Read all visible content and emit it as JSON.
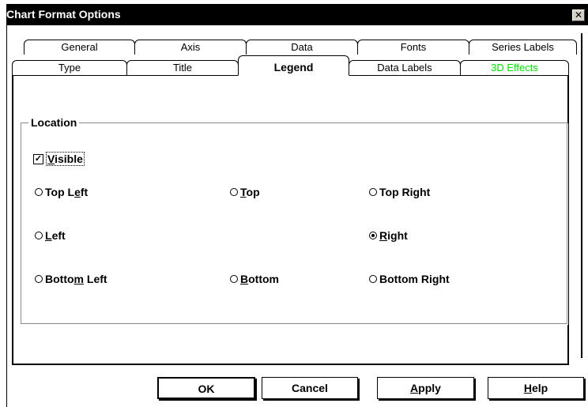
{
  "window": {
    "title": "Chart Format Options",
    "close_symbol": "✕"
  },
  "tabs_back": [
    {
      "label": "General"
    },
    {
      "label": "Axis"
    },
    {
      "label": "Data"
    },
    {
      "label": "Fonts"
    },
    {
      "label": "Series Labels"
    }
  ],
  "tabs_front": [
    {
      "label": "Type"
    },
    {
      "label": "Title"
    },
    {
      "label": "Legend",
      "active": true
    },
    {
      "label": "Data Labels"
    },
    {
      "label": "3D Effects",
      "color": "#00e000"
    }
  ],
  "location": {
    "group_label": "Location",
    "visible": {
      "label_pre": "",
      "mnemonic": "V",
      "label_post": "isible",
      "checked": true,
      "check_symbol": "✓"
    },
    "options": {
      "top_left": {
        "pre": "Top L",
        "mn": "e",
        "post": "ft",
        "selected": false
      },
      "top": {
        "pre": "",
        "mn": "T",
        "post": "op",
        "selected": false
      },
      "top_right": {
        "pre": "Top Ri",
        "mn": "g",
        "post": "ht",
        "selected": false
      },
      "left": {
        "pre": "",
        "mn": "L",
        "post": "eft",
        "selected": false
      },
      "right": {
        "pre": "",
        "mn": "R",
        "post": "ight",
        "selected": true
      },
      "bottom_left": {
        "pre": "Botto",
        "mn": "m",
        "post": " Left",
        "selected": false
      },
      "bottom": {
        "pre": "",
        "mn": "B",
        "post": "ottom",
        "selected": false
      },
      "bottom_right": {
        "pre": "Bottom Ri",
        "mn": "g",
        "post": "ht",
        "selected": false
      }
    }
  },
  "buttons": {
    "ok": {
      "label": "OK"
    },
    "cancel": {
      "label": "Cancel"
    },
    "apply": {
      "pre": "",
      "mn": "A",
      "post": "pply"
    },
    "help": {
      "pre": "",
      "mn": "H",
      "post": "elp"
    }
  }
}
